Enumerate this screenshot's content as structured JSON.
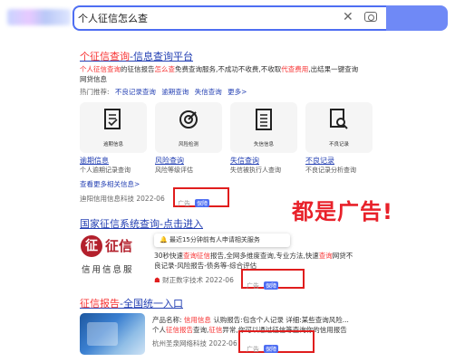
{
  "search": {
    "query": "个人征信怎么查"
  },
  "results": {
    "r1": {
      "title_a": "个征信查询",
      "title_b": "-信息查询平台",
      "snippet1_a": "个人征信查询",
      "snippet1_b": "的征信报告",
      "snippet1_c": "怎么查",
      "snippet1_d": "免费查询",
      "snippet1_e": "服务,不成功不收费,不收取",
      "snippet1_f": "代查费用",
      "snippet1_g": ",出结果一键查询",
      "snippet2": "网贷信息",
      "quick_label": "热门推荐:",
      "quick_links": [
        "不良记录查询",
        "逾期查询",
        "失信查询",
        "更多>"
      ],
      "cards": [
        {
          "icon": "report-doc-icon",
          "caption": "逾期信息"
        },
        {
          "icon": "risk-scan-icon",
          "caption": "风险检测"
        },
        {
          "icon": "list-doc-icon",
          "caption": "失信信息"
        },
        {
          "icon": "search-doc-icon",
          "caption": "不良记录"
        }
      ],
      "card_texts": [
        {
          "t1": "逾期信息",
          "t2a": "个人逾期记录查询",
          "t2b": "查看更多相关信息>"
        },
        {
          "t1": "风险查询",
          "t2a": "风险等级评估"
        },
        {
          "t1": "失信查询",
          "t2a": "失信被执行人查询"
        },
        {
          "t1": "不良记录",
          "t2a": "不良记录分析查询"
        }
      ],
      "footer_source": "迪阳信用信息科技 2022-06",
      "ad_label": "广告",
      "shield_label": "保障"
    },
    "r2": {
      "title_a": "国家征信系统查询",
      "title_b": "-点击进入",
      "logo_char": "征",
      "logo_text": "征信",
      "logo_sub": "信用信息服",
      "tooltip": "最近15分钟前有人申请相关服务",
      "snippet1_a": "30秒快速",
      "snippet1_b": "查询征信",
      "snippet1_c": "报告,全网多维度查询,专业方法,快速",
      "snippet1_d": "查询",
      "snippet1_e": "网贷不",
      "snippet2": "良记录-风险报告-债务等-综合评估",
      "source": "财正数字技术 2022-06",
      "ad_label": "广告",
      "shield_label": "保障"
    },
    "r3": {
      "title_a": "征信报告",
      "title_b": "-全国统一入口",
      "line1_a": "产品名称:",
      "line1_b": "信用信息",
      "line1_c": "认购报告:包含个人记录",
      "line1_d": "详细:某些查询风险...",
      "line2_a": "个人",
      "line2_b": "征信报告",
      "line2_c": "查询,",
      "line2_d": "征信",
      "line2_e": "异常,你可以通过征信等查询你的信用报告",
      "source": "杭州圣泉网络科技 2022-06",
      "ad_label": "广告",
      "shield_label": "保障"
    }
  },
  "annotation": {
    "text": "都是广告!"
  }
}
